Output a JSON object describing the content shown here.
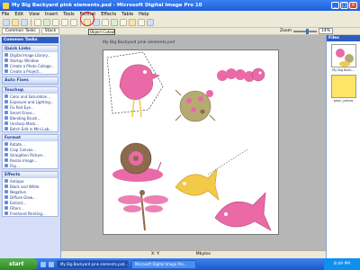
{
  "window": {
    "title": "My Big Backyard pink elements.psd - Microsoft Digital Image Pro 10"
  },
  "menu": [
    "File",
    "Edit",
    "View",
    "Insert",
    "Tools",
    "Format",
    "Effects",
    "Table",
    "Help"
  ],
  "tabs": {
    "common_tasks": "Common Tasks",
    "stack": "Stack"
  },
  "tooltip": "Object Cutout",
  "zoom": {
    "value": "14%",
    "label": "Zoom"
  },
  "taskpane": {
    "title": "Common Tasks",
    "sections": [
      {
        "heading": "Quick Links",
        "items": [
          "Digital Image Library...",
          "Startup Window",
          "Create a Photo Collage...",
          "Create a Project..."
        ]
      },
      {
        "heading": "Auto Fixes",
        "items": []
      },
      {
        "heading": "Touchup",
        "items": [
          "Color and Saturation...",
          "Exposure and Lighting...",
          "Fix Red Eye...",
          "Smart Erase...",
          "Blending Brush...",
          "Unsharp Mask...",
          "Batch Edit in Mini Lab..."
        ]
      },
      {
        "heading": "Format",
        "items": [
          "Rotate...",
          "Crop Canvas...",
          "Straighten Picture...",
          "Resize Image...",
          "Flip..."
        ]
      },
      {
        "heading": "Effects",
        "items": [
          "Antique",
          "Black and White",
          "Negative",
          "Diffuse Glow...",
          "Extract...",
          "Filters...",
          "Freehand Painting..."
        ]
      }
    ]
  },
  "workspace": {
    "image_tab": "My Big Backyard pink elements.psd"
  },
  "files": {
    "title": "Files",
    "thumbs": [
      "My Big Back...",
      "plain_yellow"
    ]
  },
  "status": {
    "coords": "X: Y:",
    "size": "Mbytes"
  },
  "taskbar": {
    "start": "start",
    "buttons": [
      "My Big Backyard pink elements.psd...",
      "Microsoft Digital Image Pro..."
    ],
    "clock": "8:49 PM"
  },
  "colors": {
    "accent": "#2d5cc4",
    "highlight": "#e3141b",
    "pink": "#e96aa6",
    "yellow": "#f3c948",
    "brown": "#8b6b4b"
  }
}
